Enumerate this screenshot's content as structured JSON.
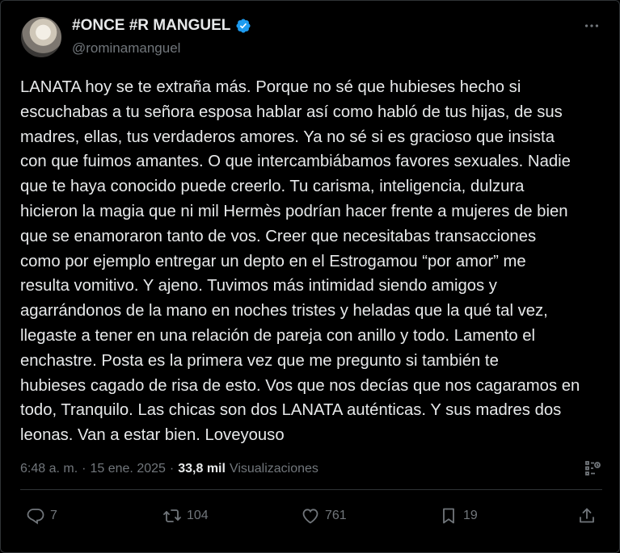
{
  "author": {
    "display_name": "#ONCE #R MANGUEL",
    "handle": "@rominamanguel"
  },
  "tweet": {
    "text": "LANATA hoy se te extraña más. Porque no sé que hubieses hecho si\nescuchabas a tu señora esposa hablar así como habló de tus hijas, de sus\nmadres, ellas, tus verdaderos amores. Ya no sé si es gracioso que insista\ncon que fuimos amantes. O que intercambiábamos favores sexuales. Nadie\nque te haya conocido puede creerlo. Tu carisma, inteligencia, dulzura\nhicieron la magia que ni mil Hermès podrían hacer frente a mujeres de bien\nque se enamoraron tanto de vos. Creer que necesitabas transacciones\ncomo por ejemplo entregar un depto en el Estrogamou “por amor” me\nresulta vomitivo.  Y ajeno. Tuvimos más intimidad siendo amigos y\nagarrándonos de la mano en noches tristes y heladas que la qué tal vez,\nllegaste a tener en una relación de pareja con anillo y todo.  Lamento el\nenchastre.  Posta es la primera vez que  me pregunto si también te\nhubieses cagado de risa de esto. Vos que nos decías que nos cagaramos en\ntodo,  Tranquilo. Las chicas son dos LANATA auténticas. Y sus madres dos\nleonas.  Van a estar bien. Loveyouso"
  },
  "meta": {
    "time": "6:48 a. m.",
    "sep1": "·",
    "date": "15 ene. 2025",
    "sep2": "·",
    "views_count": "33,8 mil",
    "views_label": "Visualizaciones"
  },
  "actions": {
    "replies": "7",
    "retweets": "104",
    "likes": "761",
    "bookmarks": "19"
  },
  "icons": {
    "verified": "verified-badge-icon",
    "more": "more-options-icon",
    "analytics": "analytics-icon",
    "reply": "reply-icon",
    "retweet": "retweet-icon",
    "like": "heart-icon",
    "bookmark": "bookmark-icon",
    "share": "share-icon"
  },
  "colors": {
    "background": "#000000",
    "text": "#e7e9ea",
    "secondary": "#71767b",
    "verified": "#1d9bf0",
    "border": "#2f3336"
  }
}
